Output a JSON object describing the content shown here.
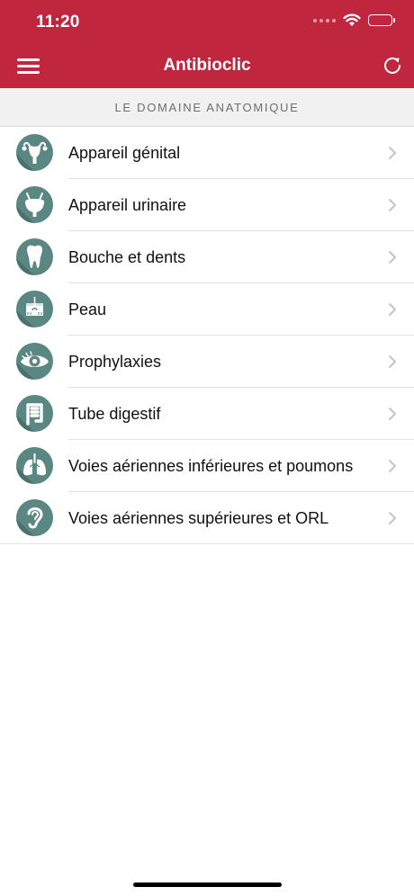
{
  "status_bar": {
    "time": "11:20"
  },
  "header": {
    "title": "Antibioclic",
    "menu_icon": "hamburger-menu-icon",
    "refresh_icon": "refresh-icon",
    "background_color": "#c1263f"
  },
  "section": {
    "title": "LE DOMAINE ANATOMIQUE"
  },
  "domains": [
    {
      "label": "Appareil génital",
      "icon": "uterus-icon"
    },
    {
      "label": "Appareil urinaire",
      "icon": "bladder-icon"
    },
    {
      "label": "Bouche et dents",
      "icon": "tooth-icon"
    },
    {
      "label": "Peau",
      "icon": "skin-icon"
    },
    {
      "label": "Prophylaxies",
      "icon": "eye-icon"
    },
    {
      "label": "Tube digestif",
      "icon": "intestine-icon"
    },
    {
      "label": "Voies aériennes inférieures et poumons",
      "icon": "lungs-icon"
    },
    {
      "label": "Voies aériennes supérieures et ORL",
      "icon": "ear-icon"
    }
  ],
  "icon_color": "#5b8783"
}
